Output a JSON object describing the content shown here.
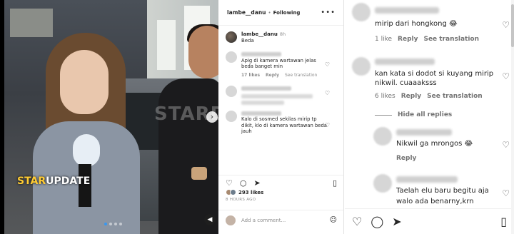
{
  "post": {
    "author": "lambe__danu",
    "separator": "•",
    "follow_status": "Following",
    "more_icon": "more-horizontal-icon",
    "caption": {
      "username": "lambe__danu",
      "time": "8h",
      "text": "Beda"
    },
    "media": {
      "watermark": "STARDI",
      "brand_prefix": "STAR",
      "brand_suffix": "UPDATE"
    },
    "comments": [
      {
        "text": "Apig di kamera wartawan jelas beda banget min",
        "likes": "17 likes",
        "reply": "Reply",
        "translate": "See translation"
      },
      {
        "text": "",
        "likes": "",
        "reply": "",
        "translate": ""
      },
      {
        "text": "Kalo di sosmed sekilas mirip tp dikit, klo di kamera wartawan beda jauh",
        "likes": "",
        "reply": "",
        "translate": ""
      }
    ],
    "likes_count": "293 likes",
    "posted_ago": "8 HOURS AGO",
    "add_comment_placeholder": "Add a comment..."
  },
  "thread": {
    "comments": [
      {
        "text": "mirip dari hongkong 😂",
        "likes": "1 like",
        "reply": "Reply",
        "translate": "See translation"
      },
      {
        "text_line1": "kan kata si dodot si kuyang mirip",
        "text_line2": "nikwil. cuaaaksss",
        "likes": "6 likes",
        "reply": "Reply",
        "translate": "See translation"
      }
    ],
    "hide_replies": "Hide all replies",
    "replies": [
      {
        "text": "Nikwil ga mrongos 😂",
        "reply": "Reply"
      },
      {
        "text_line1": "Taelah elu baru begitu aja",
        "text_line2": "walo ada benarny,krn"
      }
    ]
  }
}
